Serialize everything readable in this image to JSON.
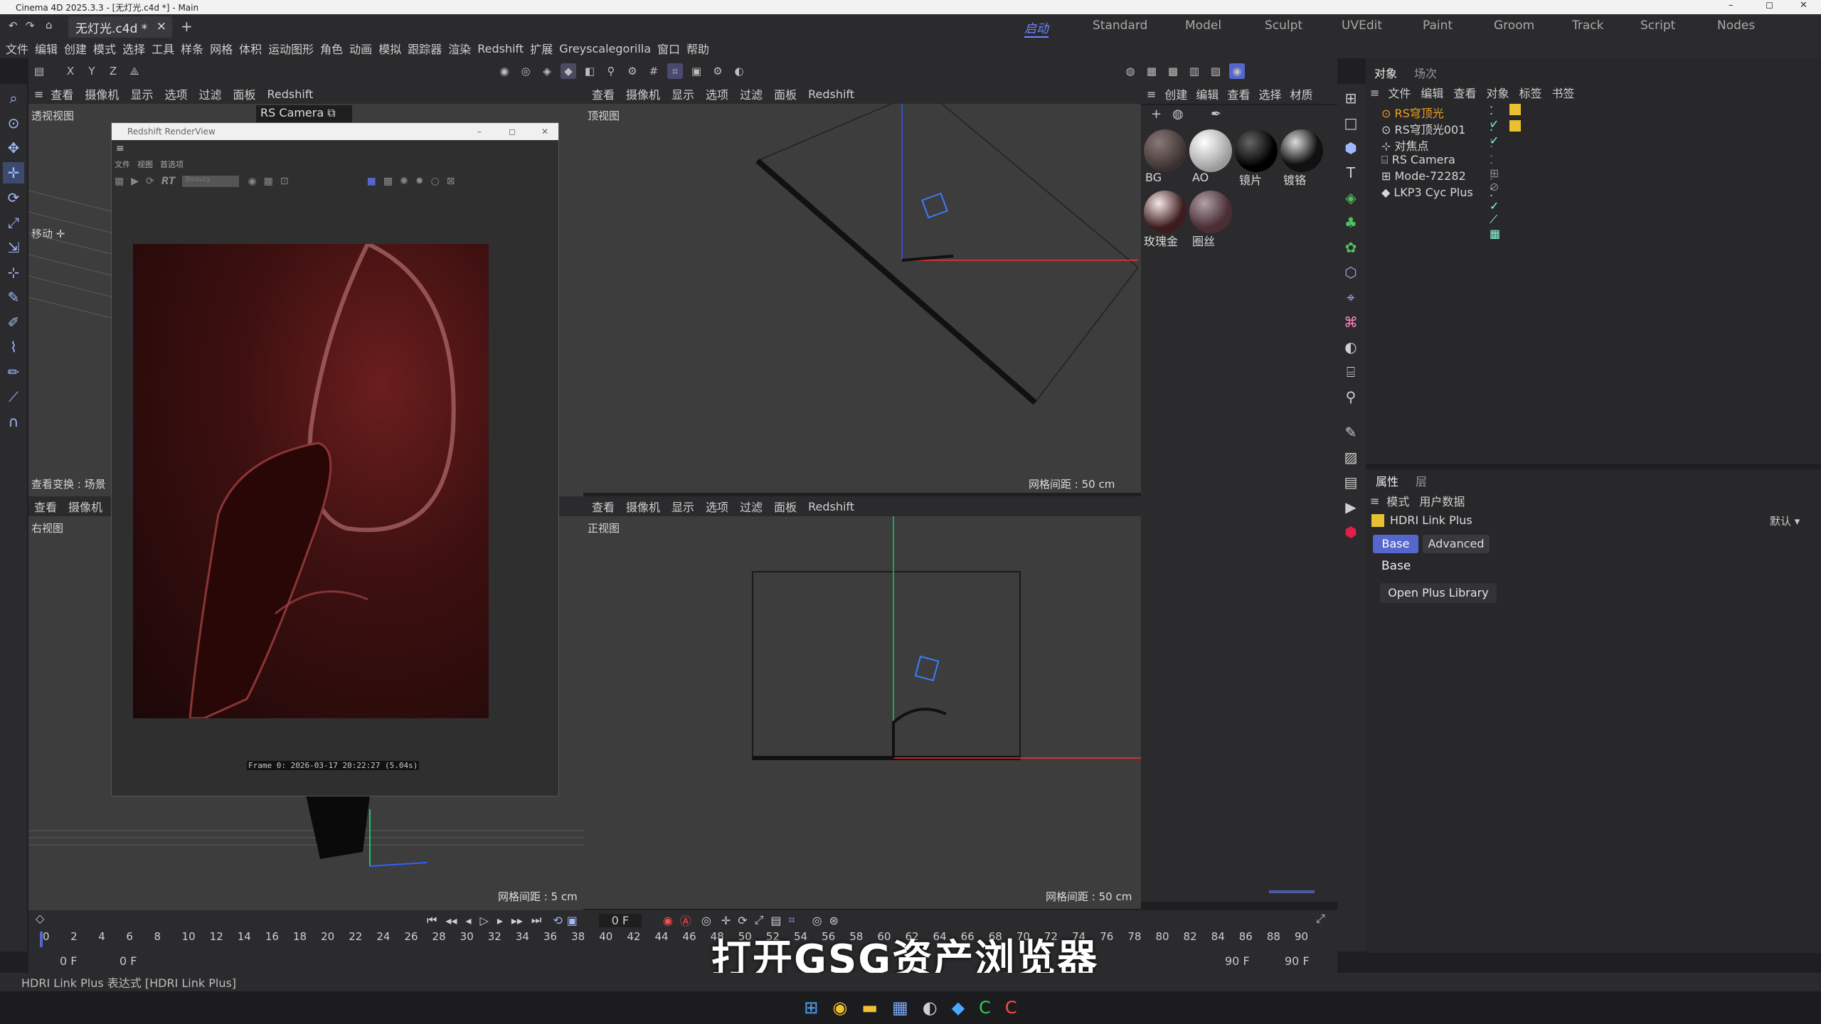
{
  "window": {
    "title": "Cinema 4D 2025.3.3 - [无灯光.c4d *] - Main",
    "file_tab": "无灯光.c4d *"
  },
  "layouts": [
    "启动",
    "Standard",
    "Model",
    "Sculpt",
    "UVEdit",
    "Paint",
    "Groom",
    "Track",
    "Script",
    "Nodes"
  ],
  "menu": [
    "文件",
    "编辑",
    "创建",
    "模式",
    "选择",
    "工具",
    "样条",
    "网格",
    "体积",
    "运动图形",
    "角色",
    "动画",
    "模拟",
    "跟踪器",
    "渲染",
    "Redshift",
    "扩展",
    "Greyscalegorilla",
    "窗口",
    "帮助"
  ],
  "viewport_menu": [
    "查看",
    "摄像机",
    "显示",
    "选项",
    "过滤",
    "面板",
    "Redshift"
  ],
  "viewports": {
    "perspective": {
      "label": "透视视图",
      "camera": "RS Camera",
      "move": "移动",
      "grid": "网格间距 : 5 cm",
      "view_transform": "查看变换 : 场景"
    },
    "top": {
      "label": "顶视图",
      "grid": "网格间距 : 50 cm"
    },
    "front": {
      "label": "正视图",
      "grid": "网格间距 : 50 cm"
    },
    "right": {
      "label": "右视图",
      "menu_a": "查看",
      "menu_b": "摄像机"
    }
  },
  "renderview": {
    "title": "Redshift RenderView",
    "menu": [
      "文件",
      "视图",
      "首选项"
    ],
    "rt": "RT",
    "aov": "Beauty",
    "frame_info": "Frame  0:  2026-03-17  20:22:27  (5.04s)"
  },
  "material_panel": {
    "menu": [
      "创建",
      "编辑",
      "查看",
      "选择",
      "材质"
    ],
    "materials": [
      {
        "name": "BG"
      },
      {
        "name": "AO"
      },
      {
        "name": "镜片"
      },
      {
        "name": "镀铬"
      },
      {
        "name": "玫瑰金"
      },
      {
        "name": "圈丝"
      }
    ]
  },
  "object_panel": {
    "tabs": [
      "对象",
      "场次"
    ],
    "menu": [
      "文件",
      "编辑",
      "查看",
      "对象",
      "标签",
      "书签"
    ],
    "objects": [
      {
        "name": "RS穹顶光",
        "selected": true
      },
      {
        "name": "RS穹顶光001"
      },
      {
        "name": "对焦点"
      },
      {
        "name": "RS Camera"
      },
      {
        "name": "Mode-72282"
      },
      {
        "name": "LKP3 Cyc Plus"
      }
    ]
  },
  "attr_panel": {
    "tabs": [
      "属性",
      "层"
    ],
    "sub": [
      "模式",
      "用户数据"
    ],
    "object": "HDRI Link Plus",
    "preset": "默认",
    "tab_base": "Base",
    "tab_adv": "Advanced",
    "section": "Base",
    "button": "Open Plus Library"
  },
  "timeline": {
    "ticks": [
      "0",
      "2",
      "4",
      "6",
      "8",
      "10",
      "12",
      "14",
      "16",
      "18",
      "20",
      "22",
      "24",
      "26",
      "28",
      "30",
      "32",
      "34",
      "36",
      "38",
      "40",
      "42",
      "44",
      "46",
      "48",
      "50",
      "52",
      "54",
      "56",
      "58",
      "60",
      "62",
      "64",
      "66",
      "68",
      "70",
      "72",
      "74",
      "76",
      "78",
      "80",
      "82",
      "84",
      "86",
      "88",
      "90"
    ],
    "current_frame": "0 F",
    "start": "0 F",
    "start2": "0 F",
    "end": "90 F",
    "end2": "90 F"
  },
  "status": "HDRI Link Plus 表达式 [HDRI Link Plus]",
  "subtitle": "打开GSG资产浏览器",
  "colors": {
    "accent": "#5566cc",
    "selected_obj": "#f0a020"
  }
}
